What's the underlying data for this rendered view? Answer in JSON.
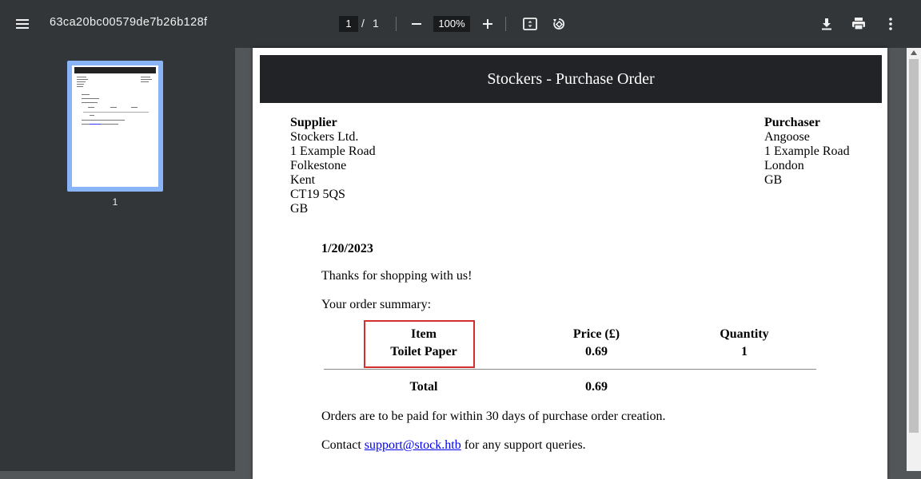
{
  "toolbar": {
    "title": "63ca20bc00579de7b26b128f",
    "current_page": "1",
    "page_separator": "/",
    "total_pages": "1",
    "zoom": "100%",
    "icons": [
      "menu-icon",
      "zoom-out-icon",
      "zoom-in-icon",
      "fit-page-icon",
      "rotate-icon",
      "download-icon",
      "print-icon",
      "more-vert-icon"
    ]
  },
  "sidebar": {
    "thumbnail_label": "1"
  },
  "document": {
    "header": "Stockers - Purchase Order",
    "supplier": {
      "heading": "Supplier",
      "lines": [
        "Stockers Ltd.",
        "1 Example Road",
        "Folkestone",
        "Kent",
        "CT19 5QS",
        "GB"
      ]
    },
    "purchaser": {
      "heading": "Purchaser",
      "lines": [
        "Angoose",
        "1 Example Road",
        "London",
        "GB"
      ]
    },
    "date": "1/20/2023",
    "thanks": "Thanks for shopping with us!",
    "summary_label": "Your order summary:",
    "table": {
      "headers": [
        "Item",
        "Price (£)",
        "Quantity"
      ],
      "row": [
        "Toilet Paper",
        "0.69",
        "1"
      ],
      "total_label": "Total",
      "total_value": "0.69"
    },
    "payment_note": "Orders are to be paid for within 30 days of purchase order creation.",
    "contact_prefix": "Contact ",
    "contact_email": "support@stock.htb",
    "contact_suffix": " for any support queries."
  },
  "colors": {
    "toolbar_bg": "#323639",
    "viewer_bg": "#525659",
    "thumbnail_highlight": "#8ab4f8",
    "annotation_box": "#d32f2f",
    "link": "#0000ee"
  }
}
